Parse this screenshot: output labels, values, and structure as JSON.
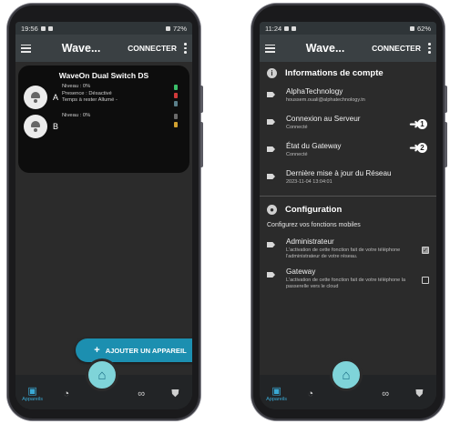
{
  "left_phone": {
    "status": {
      "time": "19:56",
      "right": "72%"
    },
    "appbar": {
      "title": "Wave...",
      "connect": "CONNECTER"
    },
    "device": {
      "title": "WaveOn Dual Switch DS",
      "channels": [
        {
          "letter": "A",
          "lines": [
            "Niveau : 0%",
            "Presence : Désactivé",
            "Temps à rester Allumé -"
          ]
        },
        {
          "letter": "B",
          "lines": [
            "Niveau : 0%"
          ]
        }
      ]
    },
    "add_button": {
      "icon": "+",
      "label": "AJOUTER UN APPAREIL"
    },
    "nav": {
      "devices_label": "Appareils"
    }
  },
  "right_phone": {
    "status": {
      "time": "11:24",
      "right": "62%"
    },
    "appbar": {
      "title": "Wave...",
      "connect": "CONNECTER"
    },
    "account": {
      "heading": "Informations de compte",
      "items": [
        {
          "title": "AlphaTechnology",
          "sub": "houssem.ouali@alphatechnology.tn"
        },
        {
          "title": "Connexion au Serveur",
          "sub": "Connecté"
        },
        {
          "title": "État du Gateway",
          "sub": "Connecté"
        },
        {
          "title": "Dernière mise à jour du Réseau",
          "sub": "2023-11-04 13:04:01"
        }
      ]
    },
    "config": {
      "heading": "Configuration",
      "description": "Configurez vos fonctions mobiles",
      "items": [
        {
          "title": "Administrateur",
          "sub": "L'activation de cette fonction fait de votre téléphone l'administrateur de votre réseau.",
          "checked": true
        },
        {
          "title": "Gateway",
          "sub": "L'activation de cette fonction fait de votre téléphone la passerelle vers le cloud",
          "checked": false
        }
      ]
    },
    "markers": [
      "1",
      "2"
    ],
    "nav": {
      "devices_label": "Appareils"
    }
  },
  "colors": {
    "accent": "#1c8fb0",
    "home_fab": "#7fd4d9",
    "appbar": "#3a4043",
    "screen_bg": "#2b2b2b"
  }
}
